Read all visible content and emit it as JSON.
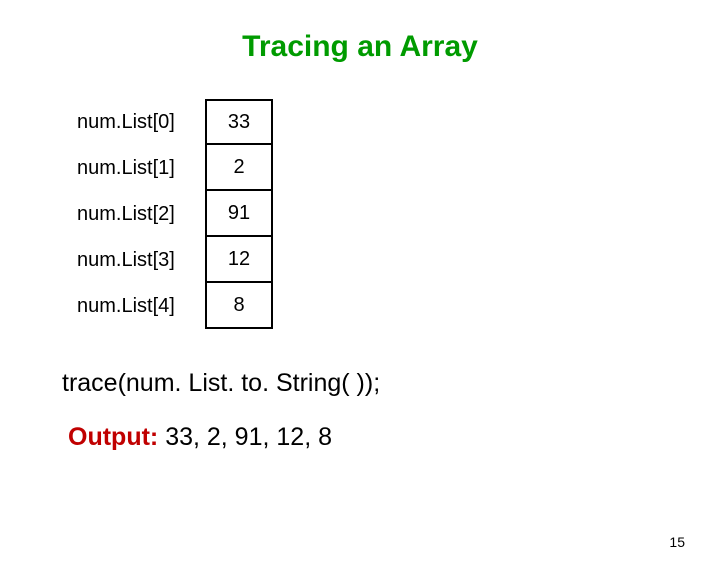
{
  "title": "Tracing an Array",
  "array": {
    "rows": [
      {
        "label": "num.List[0]",
        "value": "33"
      },
      {
        "label": "num.List[1]",
        "value": "2"
      },
      {
        "label": "num.List[2]",
        "value": "91"
      },
      {
        "label": "num.List[3]",
        "value": "12"
      },
      {
        "label": "num.List[4]",
        "value": "8"
      }
    ]
  },
  "code_line": "trace(num. List. to. String( ));",
  "output": {
    "label": "Output: ",
    "values": "33, 2, 91, 12, 8"
  },
  "page_number": "15"
}
